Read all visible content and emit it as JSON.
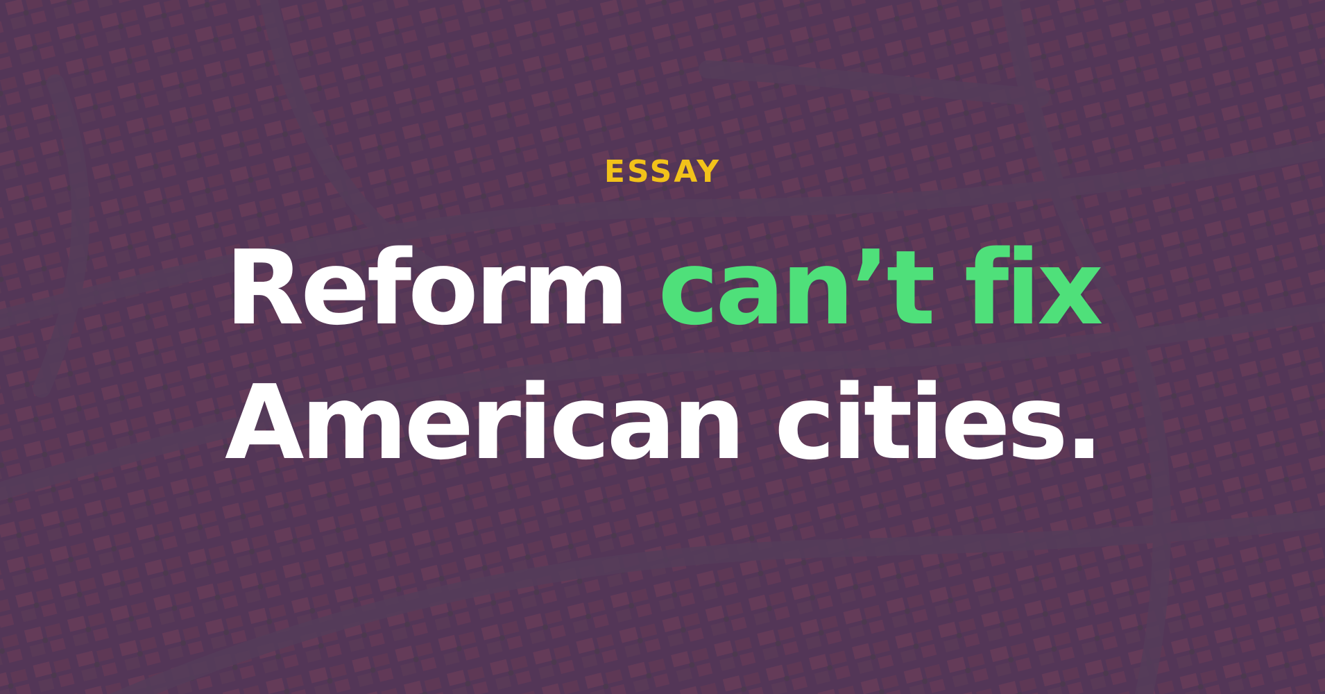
{
  "hero": {
    "kicker": "ESSAY",
    "headline": {
      "line1_plain": "Reform ",
      "line1_accent": "can’t fix",
      "line2": "American cities."
    }
  },
  "colors": {
    "kicker": "#f2c21a",
    "accent": "#4fe07a",
    "text": "#ffffff",
    "overlay": "#4e3254"
  }
}
